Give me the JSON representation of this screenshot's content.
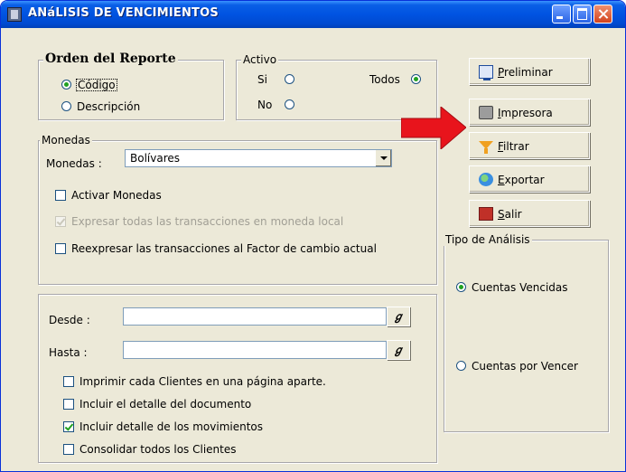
{
  "window": {
    "title": "ANáLISIS DE VENCIMIENTOS"
  },
  "orden": {
    "legend": "Orden del Reporte",
    "codigo": "Código",
    "descripcion": "Descripción",
    "selected": "Código"
  },
  "activo": {
    "legend": "Activo",
    "si": "Si",
    "no": "No",
    "todos": "Todos",
    "selected": "Todos"
  },
  "monedas": {
    "legend": "Monedas",
    "label": "Monedas :",
    "value": "Bolívares",
    "activar": "Activar Monedas",
    "expresar": "Expresar todas las transacciones en moneda local",
    "reexpresar": "Reexpresar las transacciones al Factor de cambio actual"
  },
  "rango": {
    "desde_label": "Desde  :",
    "hasta_label": "Hasta   :",
    "desde_value": "",
    "hasta_value": "",
    "imprimir": "Imprimir cada Clientes  en una página aparte.",
    "incluir_doc": "Incluir el detalle del documento",
    "incluir_mov": "Incluir detalle de los movimientos",
    "consolidar": "Consolidar todos los Clientes"
  },
  "buttons": {
    "preliminar": "Preliminar",
    "impresora": "Impresora",
    "filtrar": "Filtrar",
    "exportar": "Exportar",
    "salir": "Salir"
  },
  "tipo": {
    "legend": "Tipo de Análisis",
    "vencidas": "Cuentas Vencidas",
    "por_vencer": "Cuentas por Vencer",
    "selected": "Cuentas Vencidas"
  },
  "colors": {
    "title_bar": "#0053e1",
    "dialog_bg": "#ece9d8",
    "arrow": "#e8141c",
    "radio_dot": "#21a121"
  }
}
